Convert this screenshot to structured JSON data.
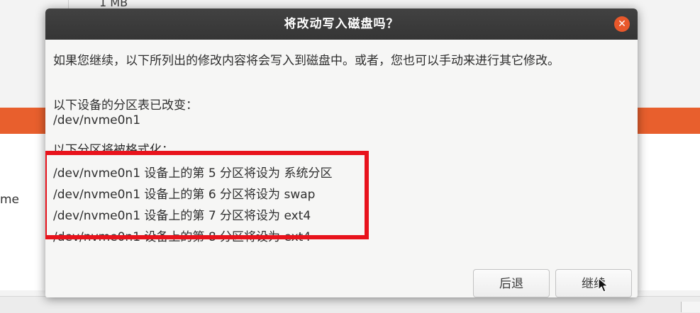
{
  "background": {
    "partition_size": "1 MB",
    "left_fragment": "me"
  },
  "dialog": {
    "title": "将改动写入磁盘吗？",
    "close_icon": "close-icon",
    "message": "如果您继续，以下所列出的修改内容将会写入到磁盘中。或者，您也可以手动来进行其它修改。",
    "partition_table_heading": "以下设备的分区表已改变：",
    "partition_table_device": "/dev/nvme0n1",
    "format_heading": "以下分区将被格式化：",
    "format_items": [
      "/dev/nvme0n1 设备上的第 5 分区将设为 系统分区",
      "/dev/nvme0n1 设备上的第 6 分区将设为 swap",
      "/dev/nvme0n1 设备上的第 7 分区将设为 ext4",
      "/dev/nvme0n1 设备上的第 8 分区将设为 ext4"
    ],
    "buttons": {
      "back": "后退",
      "continue": "继续"
    }
  },
  "colors": {
    "accent_orange": "#e85f2d",
    "highlight_red": "#e8131c",
    "titlebar": "#3a3a3a",
    "close_button": "#e9582b"
  }
}
